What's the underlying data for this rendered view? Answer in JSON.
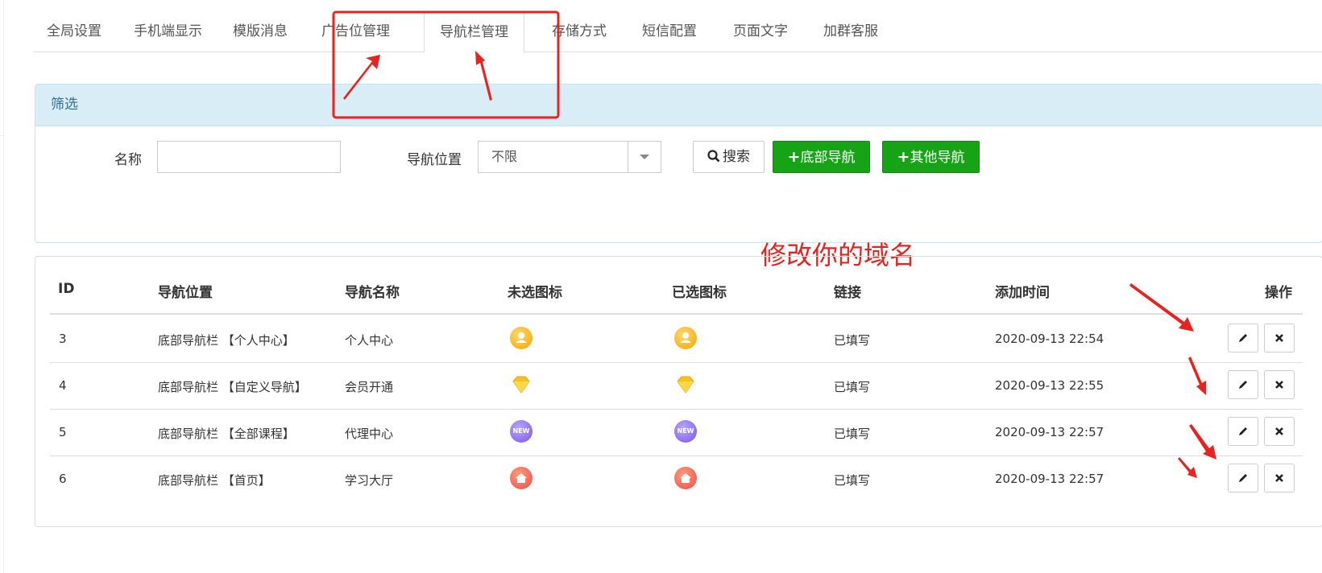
{
  "tabs": [
    {
      "label": "全局设置"
    },
    {
      "label": "手机端显示"
    },
    {
      "label": "模版消息"
    },
    {
      "label": "广告位管理"
    },
    {
      "label": "导航栏管理"
    },
    {
      "label": "存储方式"
    },
    {
      "label": "短信配置"
    },
    {
      "label": "页面文字"
    },
    {
      "label": "加群客服"
    }
  ],
  "filter": {
    "title": "筛选",
    "name_label": "名称",
    "name_value": "",
    "position_label": "导航位置",
    "position_value": "不限",
    "search_label": "搜索",
    "bottom_nav_label": "底部导航",
    "other_nav_label": "其他导航"
  },
  "table": {
    "headers": [
      "ID",
      "导航位置",
      "导航名称",
      "未选图标",
      "已选图标",
      "链接",
      "添加时间",
      "操作"
    ],
    "rows": [
      {
        "id": "3",
        "position": "底部导航栏 【个人中心】",
        "name": "个人中心",
        "icon": "user-icon",
        "link": "已填写",
        "time": "2020-09-13 22:54"
      },
      {
        "id": "4",
        "position": "底部导航栏 【自定义导航】",
        "name": "会员开通",
        "icon": "diamond-icon",
        "link": "已填写",
        "time": "2020-09-13 22:55"
      },
      {
        "id": "5",
        "position": "底部导航栏 【全部课程】",
        "name": "代理中心",
        "icon": "new-icon",
        "link": "已填写",
        "time": "2020-09-13 22:57"
      },
      {
        "id": "6",
        "position": "底部导航栏 【首页】",
        "name": "学习大厅",
        "icon": "home-icon",
        "link": "已填写",
        "time": "2020-09-13 22:57"
      }
    ],
    "new_badge": "NEW"
  },
  "annotation": {
    "text": "修改你的域名",
    "color": "#e8231f"
  },
  "colors": {
    "filter_header_bg": "#d9edf7",
    "green_button": "#16a316"
  }
}
